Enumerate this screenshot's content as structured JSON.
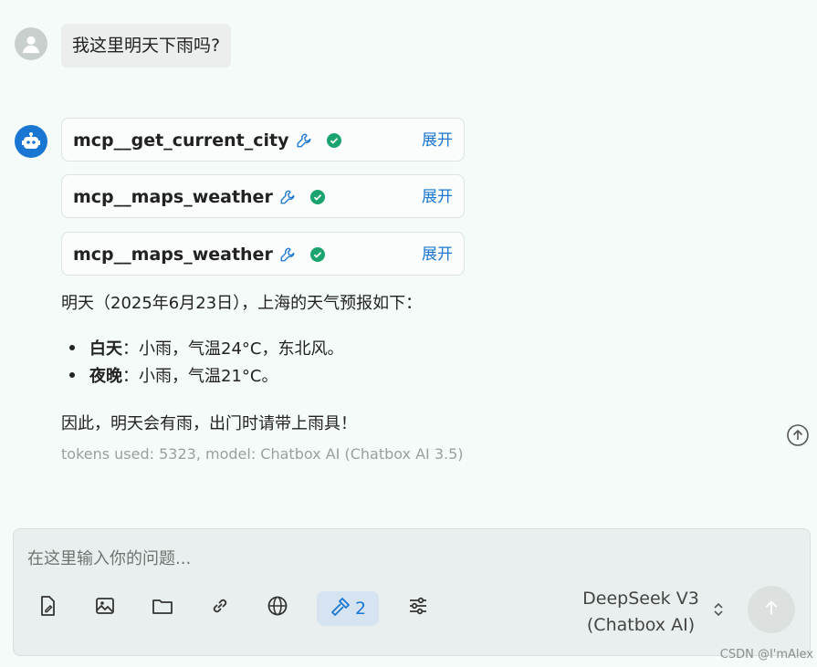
{
  "user_message": "我这里明天下雨吗?",
  "tool_calls": [
    {
      "name": "mcp__get_current_city",
      "expand_label": "展开"
    },
    {
      "name": "mcp__maps_weather",
      "expand_label": "展开"
    },
    {
      "name": "mcp__maps_weather",
      "expand_label": "展开"
    }
  ],
  "answer": {
    "intro": "明天（2025年6月23日），上海的天气预报如下：",
    "bullets": [
      {
        "label": "白天",
        "text": "：小雨，气温24°C，东北风。"
      },
      {
        "label": "夜晚",
        "text": "：小雨，气温21°C。"
      }
    ],
    "conclusion": "因此，明天会有雨，出门时请带上雨具！"
  },
  "meta": "tokens used: 5323, model: Chatbox AI (Chatbox AI 3.5)",
  "composer": {
    "placeholder": "在这里输入你的问题...",
    "mcp_count": "2",
    "model_line1": "DeepSeek V3",
    "model_line2": "(Chatbox AI)"
  },
  "watermark": "CSDN @I'mAlex",
  "colors": {
    "accent": "#1976d2",
    "success": "#1aa36f",
    "background": "#f5fbf8"
  },
  "icons": [
    "user-avatar-icon",
    "bot-avatar-icon",
    "wrench-icon",
    "check-circle-icon",
    "scroll-up-icon",
    "file-icon",
    "image-icon",
    "folder-icon",
    "link-icon",
    "globe-icon",
    "hammer-icon",
    "settings-sliders-icon",
    "chevron-updown-icon",
    "arrow-up-icon"
  ]
}
